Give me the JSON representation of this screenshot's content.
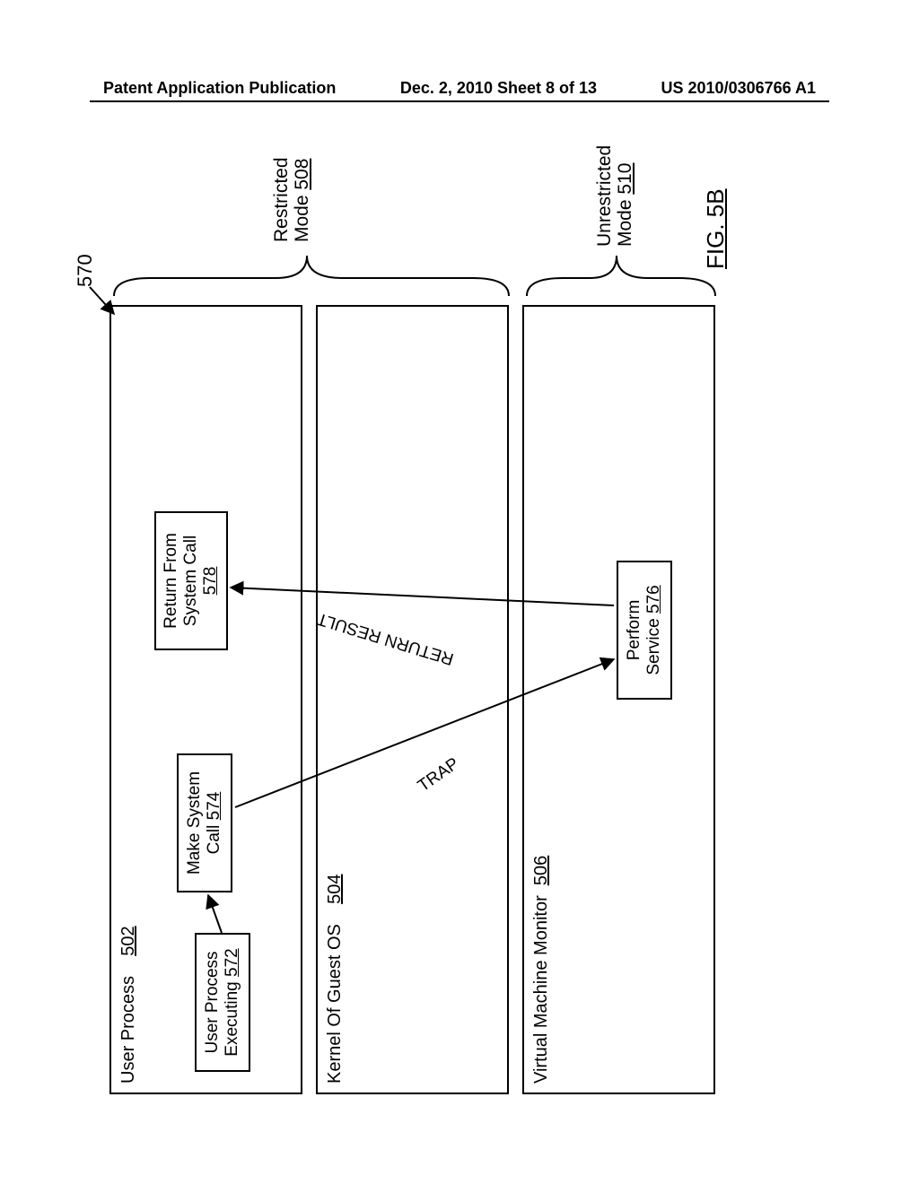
{
  "header": {
    "left": "Patent Application Publication",
    "center": "Dec. 2, 2010  Sheet 8 of 13",
    "right": "US 2010/0306766 A1"
  },
  "figure": {
    "label": "FIG. 5B",
    "ref_no": "570"
  },
  "lanes": {
    "user_process": {
      "title": "User Process",
      "ref": "502"
    },
    "kernel": {
      "title": "Kernel Of Guest OS",
      "ref": "504"
    },
    "vmm": {
      "title": "Virtual Machine Monitor",
      "ref": "506"
    }
  },
  "boxes": {
    "exec": {
      "l1": "User Process",
      "l2": "Executing",
      "ref": "572"
    },
    "make_call": {
      "l1": "Make System",
      "l2": "Call",
      "ref": "574"
    },
    "perform": {
      "l1": "Perform",
      "l2": "Service",
      "ref": "576"
    },
    "return_call": {
      "l1": "Return From",
      "l2": "System Call",
      "ref": "578"
    }
  },
  "arrows": {
    "trap": "TRAP",
    "ret": "RETURN RESULT"
  },
  "modes": {
    "restricted": {
      "l1": "Restricted",
      "l2": "Mode",
      "ref": "508"
    },
    "unrestricted": {
      "l1": "Unrestricted",
      "l2": "Mode",
      "ref": "510"
    }
  }
}
